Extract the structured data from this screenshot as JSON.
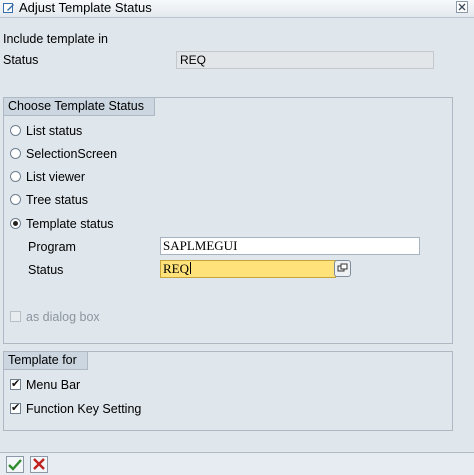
{
  "window": {
    "title": "Adjust Template Status"
  },
  "header": {
    "include_label": "Include template in",
    "status_label": "Status",
    "status_value": "REQ"
  },
  "choose_group": {
    "title": "Choose Template Status",
    "options": [
      {
        "label": "List status",
        "selected": false
      },
      {
        "label": "SelectionScreen",
        "selected": false
      },
      {
        "label": "List viewer",
        "selected": false
      },
      {
        "label": "Tree status",
        "selected": false
      },
      {
        "label": "Template status",
        "selected": true
      }
    ],
    "program_label": "Program",
    "program_value": "SAPLMEGUI",
    "status_label": "Status",
    "status_value": "REQ",
    "dialog_label": "as dialog box"
  },
  "template_for_group": {
    "title": "Template for",
    "items": [
      {
        "label": "Menu Bar",
        "checked": true
      },
      {
        "label": "Function Key Setting",
        "checked": true
      }
    ]
  },
  "toolbar": {
    "icons": [
      "confirm-icon",
      "cancel-icon"
    ],
    "colors": {
      "confirm": "#2e8b2e",
      "cancel": "#c0201f"
    }
  }
}
